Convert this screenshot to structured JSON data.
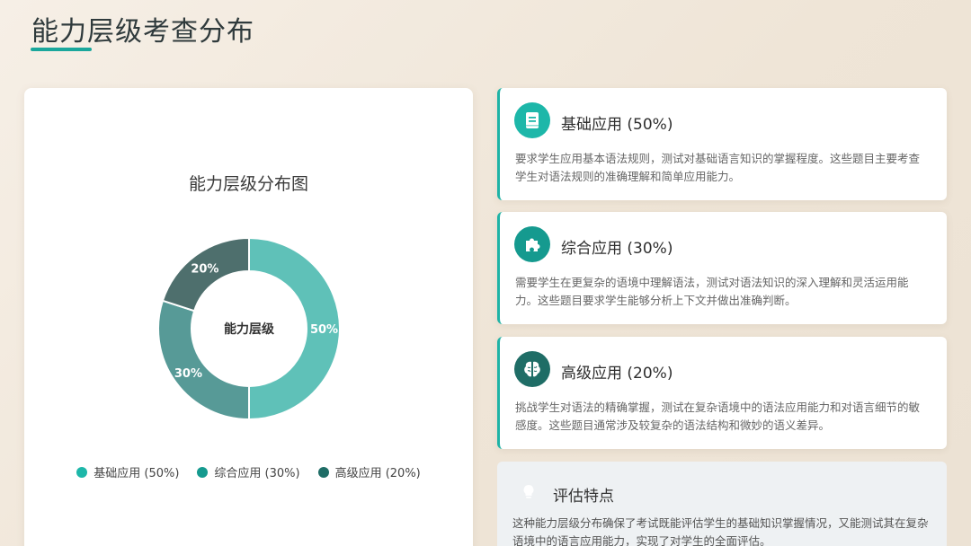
{
  "page": {
    "title": "能力层级考查分布"
  },
  "chart_data": {
    "type": "pie",
    "title": "能力层级分布图",
    "center_label": "能力层级",
    "categories": [
      "基础应用",
      "综合应用",
      "高级应用"
    ],
    "values": [
      50,
      30,
      20
    ],
    "value_labels": [
      "50%",
      "30%",
      "20%"
    ],
    "colors": [
      "#5fc1b8",
      "#579a97",
      "#4e6f6d"
    ],
    "legend": {
      "position": "bottom",
      "items": [
        "基础应用 (50%)",
        "综合应用 (30%)",
        "高级应用 (20%)"
      ],
      "colors": [
        "#1db7a9",
        "#159a8f",
        "#1f6d66"
      ]
    }
  },
  "cards": [
    {
      "title": "基础应用 (50%)",
      "description": "要求学生应用基本语法规则，测试对基础语言知识的掌握程度。这些题目主要考查学生对语法规则的准确理解和简单应用能力。",
      "icon": "book-icon",
      "color": "#1db7a9"
    },
    {
      "title": "综合应用 (30%)",
      "description": "需要学生在更复杂的语境中理解语法，测试对语法知识的深入理解和灵活运用能力。这些题目要求学生能够分析上下文并做出准确判断。",
      "icon": "puzzle-icon",
      "color": "#159a8f"
    },
    {
      "title": "高级应用 (20%)",
      "description": "挑战学生对语法的精确掌握，测试在复杂语境中的语法应用能力和对语言细节的敏感度。这些题目通常涉及较复杂的语法结构和微妙的语义差异。",
      "icon": "brain-icon",
      "color": "#1f6d66"
    }
  ],
  "summary": {
    "title": "评估特点",
    "description": "这种能力层级分布确保了考试既能评估学生的基础知识掌握情况，又能测试其在复杂语境中的语言应用能力，实现了对学生的全面评估。",
    "icon": "lightbulb-icon"
  }
}
